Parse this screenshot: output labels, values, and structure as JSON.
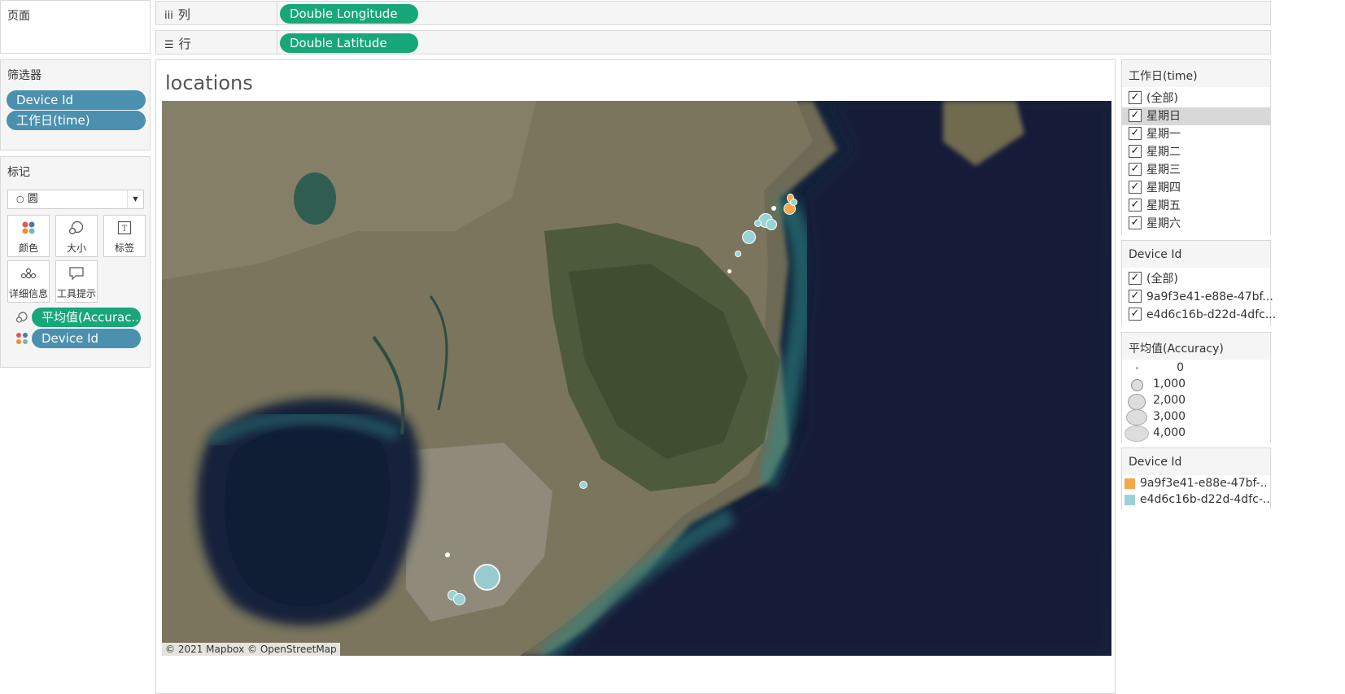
{
  "pages_label": "页面",
  "columns": {
    "label": "列",
    "pill": "Double Longitude"
  },
  "rows": {
    "label": "行",
    "pill": "Double Latitude"
  },
  "filters": {
    "title": "筛选器",
    "items": [
      "Device Id",
      "工作日(time)"
    ]
  },
  "marks": {
    "title": "标记",
    "mark_type": "圆",
    "buttons": [
      "颜色",
      "大小",
      "标签",
      "详细信息",
      "工具提示"
    ],
    "fields": [
      {
        "label": "平均值(Accurac..",
        "icon": "size-icon",
        "color": "#17a779"
      },
      {
        "label": "Device Id",
        "icon": "color-icon",
        "color": "#4b90ae"
      }
    ]
  },
  "view": {
    "title": "locations",
    "attribution": "© 2021 Mapbox © OpenStreetMap"
  },
  "weekday_filter": {
    "title": "工作日(time)",
    "options": [
      "(全部)",
      "星期日",
      "星期一",
      "星期二",
      "星期三",
      "星期四",
      "星期五",
      "星期六"
    ],
    "highlighted": 1
  },
  "device_filter": {
    "title": "Device Id",
    "options": [
      "(全部)",
      "9a9f3e41-e88e-47bf...",
      "e4d6c16b-d22d-4dfc..."
    ]
  },
  "size_legend": {
    "title": "平均值(Accuracy)",
    "values": [
      "0",
      "1,000",
      "2,000",
      "3,000",
      "4,000"
    ]
  },
  "color_legend": {
    "title": "Device Id",
    "items": [
      {
        "label": "9a9f3e41-e88e-47bf-..",
        "color": "#f4a74b"
      },
      {
        "label": "e4d6c16b-d22d-4dfc-..",
        "color": "#9ad3d6"
      }
    ]
  }
}
